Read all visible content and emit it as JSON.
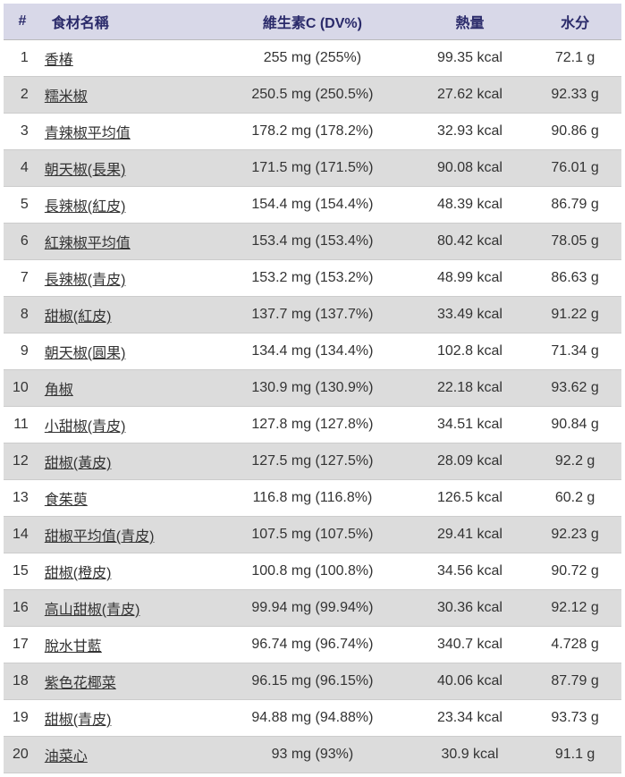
{
  "headers": {
    "idx": "#",
    "name": "食材名稱",
    "vitc": "維生素C (DV%)",
    "cal": "熱量",
    "water": "水分"
  },
  "rows": [
    {
      "idx": "1",
      "name": "香椿",
      "vitc": "255 mg (255%)",
      "cal": "99.35 kcal",
      "water": "72.1 g"
    },
    {
      "idx": "2",
      "name": "糯米椒",
      "vitc": "250.5 mg (250.5%)",
      "cal": "27.62 kcal",
      "water": "92.33 g"
    },
    {
      "idx": "3",
      "name": "青辣椒平均值",
      "vitc": "178.2 mg (178.2%)",
      "cal": "32.93 kcal",
      "water": "90.86 g"
    },
    {
      "idx": "4",
      "name": "朝天椒(長果)",
      "vitc": "171.5 mg (171.5%)",
      "cal": "90.08 kcal",
      "water": "76.01 g"
    },
    {
      "idx": "5",
      "name": "長辣椒(紅皮)",
      "vitc": "154.4 mg (154.4%)",
      "cal": "48.39 kcal",
      "water": "86.79 g"
    },
    {
      "idx": "6",
      "name": "紅辣椒平均值",
      "vitc": "153.4 mg (153.4%)",
      "cal": "80.42 kcal",
      "water": "78.05 g"
    },
    {
      "idx": "7",
      "name": "長辣椒(青皮)",
      "vitc": "153.2 mg (153.2%)",
      "cal": "48.99 kcal",
      "water": "86.63 g"
    },
    {
      "idx": "8",
      "name": "甜椒(紅皮)",
      "vitc": "137.7 mg (137.7%)",
      "cal": "33.49 kcal",
      "water": "91.22 g"
    },
    {
      "idx": "9",
      "name": "朝天椒(圓果)",
      "vitc": "134.4 mg (134.4%)",
      "cal": "102.8 kcal",
      "water": "71.34 g"
    },
    {
      "idx": "10",
      "name": "角椒",
      "vitc": "130.9 mg (130.9%)",
      "cal": "22.18 kcal",
      "water": "93.62 g"
    },
    {
      "idx": "11",
      "name": "小甜椒(青皮)",
      "vitc": "127.8 mg (127.8%)",
      "cal": "34.51 kcal",
      "water": "90.84 g"
    },
    {
      "idx": "12",
      "name": "甜椒(黃皮)",
      "vitc": "127.5 mg (127.5%)",
      "cal": "28.09 kcal",
      "water": "92.2 g"
    },
    {
      "idx": "13",
      "name": "食茱萸",
      "vitc": "116.8 mg (116.8%)",
      "cal": "126.5 kcal",
      "water": "60.2 g"
    },
    {
      "idx": "14",
      "name": "甜椒平均值(青皮)",
      "vitc": "107.5 mg (107.5%)",
      "cal": "29.41 kcal",
      "water": "92.23 g"
    },
    {
      "idx": "15",
      "name": "甜椒(橙皮)",
      "vitc": "100.8 mg (100.8%)",
      "cal": "34.56 kcal",
      "water": "90.72 g"
    },
    {
      "idx": "16",
      "name": "高山甜椒(青皮)",
      "vitc": "99.94 mg (99.94%)",
      "cal": "30.36 kcal",
      "water": "92.12 g"
    },
    {
      "idx": "17",
      "name": "脫水甘藍",
      "vitc": "96.74 mg (96.74%)",
      "cal": "340.7 kcal",
      "water": "4.728 g"
    },
    {
      "idx": "18",
      "name": "紫色花椰菜",
      "vitc": "96.15 mg (96.15%)",
      "cal": "40.06 kcal",
      "water": "87.79 g"
    },
    {
      "idx": "19",
      "name": "甜椒(青皮)",
      "vitc": "94.88 mg (94.88%)",
      "cal": "23.34 kcal",
      "water": "93.73 g"
    },
    {
      "idx": "20",
      "name": "油菜心",
      "vitc": "93 mg (93%)",
      "cal": "30.9 kcal",
      "water": "91.1 g"
    }
  ]
}
